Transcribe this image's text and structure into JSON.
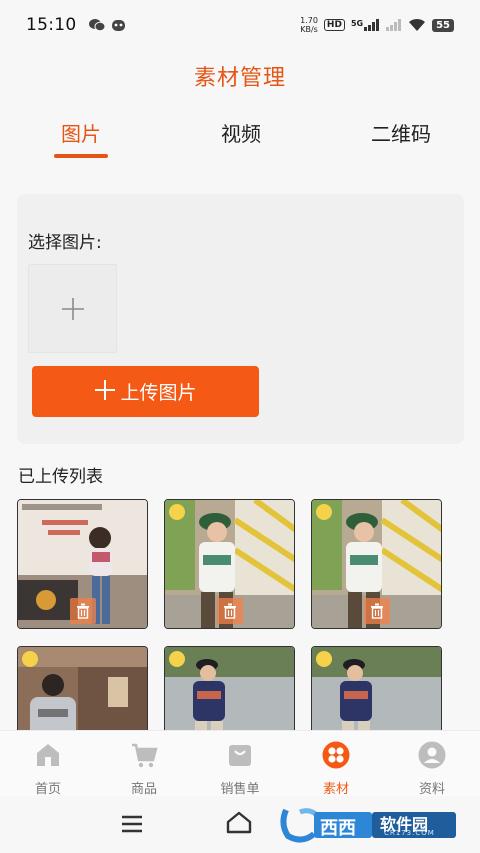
{
  "status_bar": {
    "time": "15:10",
    "net_speed_value": "1.70",
    "net_speed_unit": "KB/s",
    "hd_label": "HD",
    "signal_label": "5G",
    "battery": "55"
  },
  "header": {
    "title": "素材管理"
  },
  "tabs": [
    {
      "label": "图片",
      "active": true
    },
    {
      "label": "视频",
      "active": false
    },
    {
      "label": "二维码",
      "active": false
    }
  ],
  "select_section": {
    "label": "选择图片:",
    "upload_button_label": "上传图片"
  },
  "uploaded_section": {
    "title": "已上传列表"
  },
  "bottom_nav": [
    {
      "label": "首页",
      "icon": "home-icon"
    },
    {
      "label": "商品",
      "icon": "cart-icon"
    },
    {
      "label": "销售单",
      "icon": "bag-icon"
    },
    {
      "label": "素材",
      "icon": "material-icon",
      "active": true
    },
    {
      "label": "资料",
      "icon": "profile-icon"
    }
  ],
  "watermark": {
    "brand": "西西",
    "suffix": "软件园",
    "domain": "CR173.COM"
  },
  "colors": {
    "accent": "#f45a16",
    "title": "#e65515",
    "nav_inactive": "#bdbdbd"
  }
}
